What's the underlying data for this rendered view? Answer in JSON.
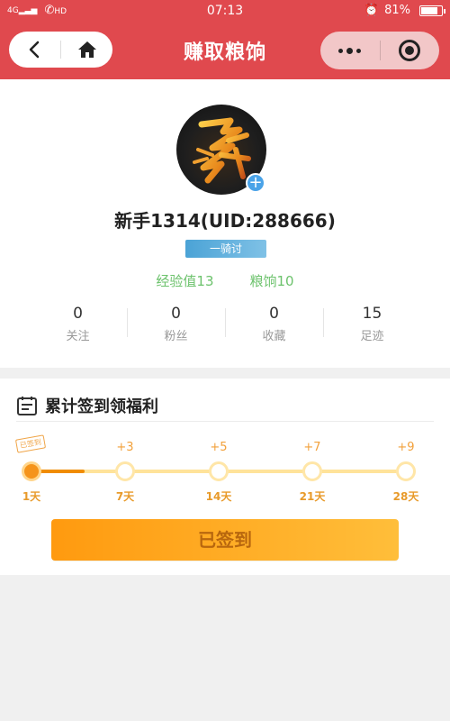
{
  "status_bar": {
    "network": "4G",
    "hd": "HD",
    "time": "07:13",
    "battery": "81%",
    "battery_level": 0.81
  },
  "header": {
    "title": "赚取粮饷"
  },
  "profile": {
    "username": "新手1314(UID:288666)",
    "rank": "一骑讨",
    "exp_label": "经验值13",
    "provisions_label": "粮饷10",
    "counts": [
      {
        "value": "0",
        "label": "关注"
      },
      {
        "value": "0",
        "label": "粉丝"
      },
      {
        "value": "0",
        "label": "收藏"
      },
      {
        "value": "15",
        "label": "足迹"
      }
    ]
  },
  "signin": {
    "title": "累计签到领福利",
    "stamp": "已签到",
    "progress_fraction": 0.14,
    "milestones": [
      {
        "reward": "",
        "day": "1天",
        "done": true
      },
      {
        "reward": "+3",
        "day": "7天",
        "done": false
      },
      {
        "reward": "+5",
        "day": "14天",
        "done": false
      },
      {
        "reward": "+7",
        "day": "21天",
        "done": false
      },
      {
        "reward": "+9",
        "day": "28天",
        "done": false
      }
    ],
    "button_label": "已签到"
  },
  "colors": {
    "header_red": "#e0494e",
    "accent_orange": "#f5941b",
    "green": "#6cc26c"
  }
}
